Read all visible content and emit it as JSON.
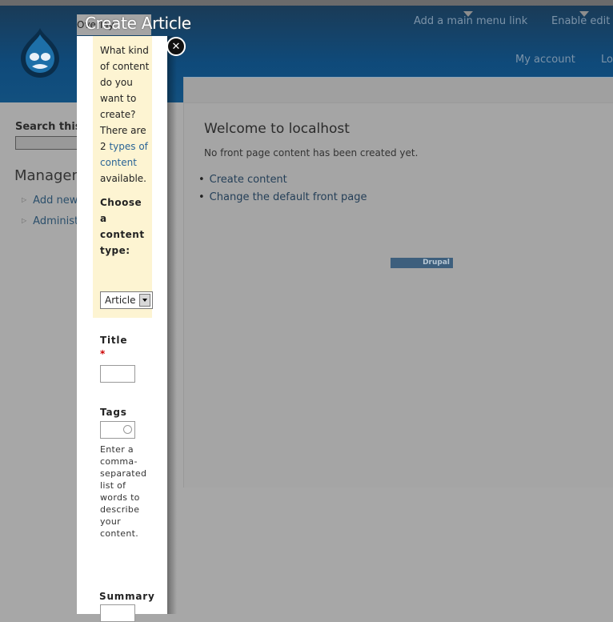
{
  "header": {
    "menu": [
      "Add a main menu link",
      "Enable edit mode"
    ],
    "secondary_menu": [
      "My account",
      "Log out"
    ]
  },
  "sidebar": {
    "search_label": "Search this site",
    "heading": "Management",
    "links": [
      "Add new content",
      "Administer"
    ]
  },
  "main": {
    "title": "Welcome to localhost",
    "message": "No front page content has been created yet.",
    "links": [
      "Create content",
      "Change the default front page"
    ],
    "badge": "Drupal"
  },
  "dialog": {
    "title": "Create Article",
    "under_tab": "Overlay",
    "close_symbol": "✕",
    "notice": {
      "text_before": "What kind of content do you want to create? There are 2",
      "link": "types of content",
      "text_after": "available."
    },
    "choose_label": "Choose a content type:",
    "select_value": "Article",
    "title_label": "Title",
    "required_mark": "*",
    "tags_label": "Tags",
    "tags_description": "Enter a comma-separated list of words to describe your content.",
    "summary_label": "Summary"
  }
}
